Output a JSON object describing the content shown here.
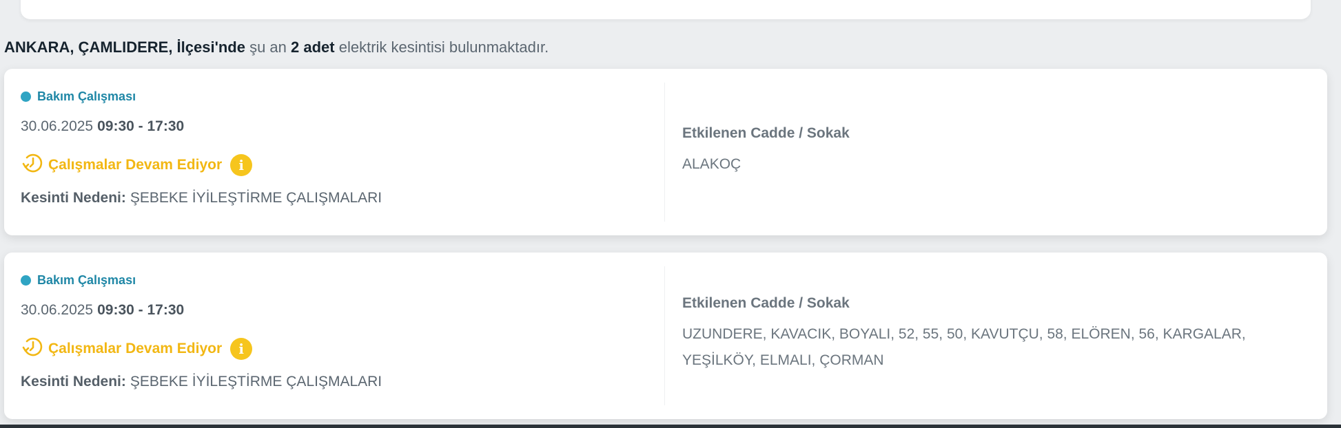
{
  "summary": {
    "location": "ANKARA, ÇAMLIDERE, İlçesi'nde",
    "prefix": "şu an",
    "count": "2 adet",
    "suffix": "elektrik kesintisi bulunmaktadır."
  },
  "outages": [
    {
      "type": "Bakım Çalışması",
      "date": "30.06.2025",
      "time": "09:30 - 17:30",
      "status": "Çalışmalar Devam Ediyor",
      "reason_label": "Kesinti Nedeni:",
      "reason": "ŞEBEKE İYİLEŞTİRME ÇALIŞMALARI",
      "streets_title": "Etkilenen Cadde / Sokak",
      "streets": "ALAKOÇ"
    },
    {
      "type": "Bakım Çalışması",
      "date": "30.06.2025",
      "time": "09:30 - 17:30",
      "status": "Çalışmalar Devam Ediyor",
      "reason_label": "Kesinti Nedeni:",
      "reason": "ŞEBEKE İYİLEŞTİRME ÇALIŞMALARI",
      "streets_title": "Etkilenen Cadde / Sokak",
      "streets": "UZUNDERE, KAVACIK, BOYALI, 52, 55, 50, KAVUTÇU, 58, ELÖREN, 56, KARGALAR, YEŞİLKÖY, ELMALI, ÇORMAN"
    }
  ],
  "icons": {
    "type_dot": "status-dot-icon",
    "status": "clock-history-icon",
    "info": "info-icon"
  },
  "colors": {
    "type_dot": "#2fa4c3",
    "type_text": "#1f87a6",
    "status": "#f2b713",
    "info": "#f6c51d"
  }
}
